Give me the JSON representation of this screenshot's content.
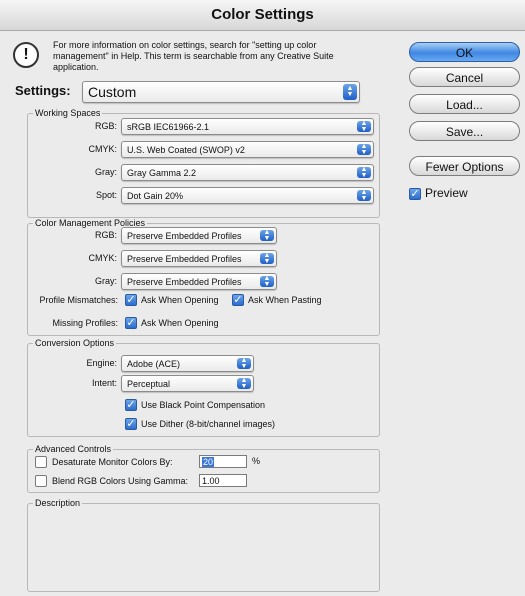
{
  "window": {
    "title": "Color Settings"
  },
  "info": {
    "icon": "exclamation-icon",
    "glyph": "!",
    "text": "For more information on color settings, search for \"setting up color management\" in Help. This term is searchable from any Creative Suite application."
  },
  "settings": {
    "label": "Settings:",
    "value": "Custom"
  },
  "working_spaces": {
    "title": "Working Spaces",
    "rgb": {
      "label": "RGB:",
      "value": "sRGB IEC61966-2.1"
    },
    "cmyk": {
      "label": "CMYK:",
      "value": "U.S. Web Coated (SWOP) v2"
    },
    "gray": {
      "label": "Gray:",
      "value": "Gray Gamma 2.2"
    },
    "spot": {
      "label": "Spot:",
      "value": "Dot Gain 20%"
    }
  },
  "policies": {
    "title": "Color Management Policies",
    "rgb": {
      "label": "RGB:",
      "value": "Preserve Embedded Profiles"
    },
    "cmyk": {
      "label": "CMYK:",
      "value": "Preserve Embedded Profiles"
    },
    "gray": {
      "label": "Gray:",
      "value": "Preserve Embedded Profiles"
    },
    "mismatch_label": "Profile Mismatches:",
    "ask_opening": "Ask When Opening",
    "ask_pasting": "Ask When Pasting",
    "missing_label": "Missing Profiles:",
    "missing_ask_opening": "Ask When Opening"
  },
  "conversion": {
    "title": "Conversion Options",
    "engine": {
      "label": "Engine:",
      "value": "Adobe (ACE)"
    },
    "intent": {
      "label": "Intent:",
      "value": "Perceptual"
    },
    "black_point": "Use Black Point Compensation",
    "dither": "Use Dither (8-bit/channel images)"
  },
  "advanced": {
    "title": "Advanced Controls",
    "desaturate_label": "Desaturate Monitor Colors By:",
    "desaturate_value": "20",
    "desaturate_unit": "%",
    "blend_label": "Blend RGB Colors Using Gamma:",
    "blend_value": "1.00"
  },
  "description": {
    "title": "Description"
  },
  "buttons": {
    "ok": "OK",
    "cancel": "Cancel",
    "load": "Load...",
    "save": "Save...",
    "fewer": "Fewer Options"
  },
  "preview": {
    "label": "Preview",
    "checked": true
  },
  "checks": {
    "ask_opening": true,
    "ask_pasting": true,
    "missing_ask": true,
    "black_point": true,
    "dither": true,
    "desaturate": false,
    "blend": false,
    "glyph": "✓"
  },
  "popup_arrows": {
    "up": "▲",
    "down": "▼"
  },
  "colors": {
    "accent": "#3f87e3",
    "selection": "#3b77d6"
  }
}
